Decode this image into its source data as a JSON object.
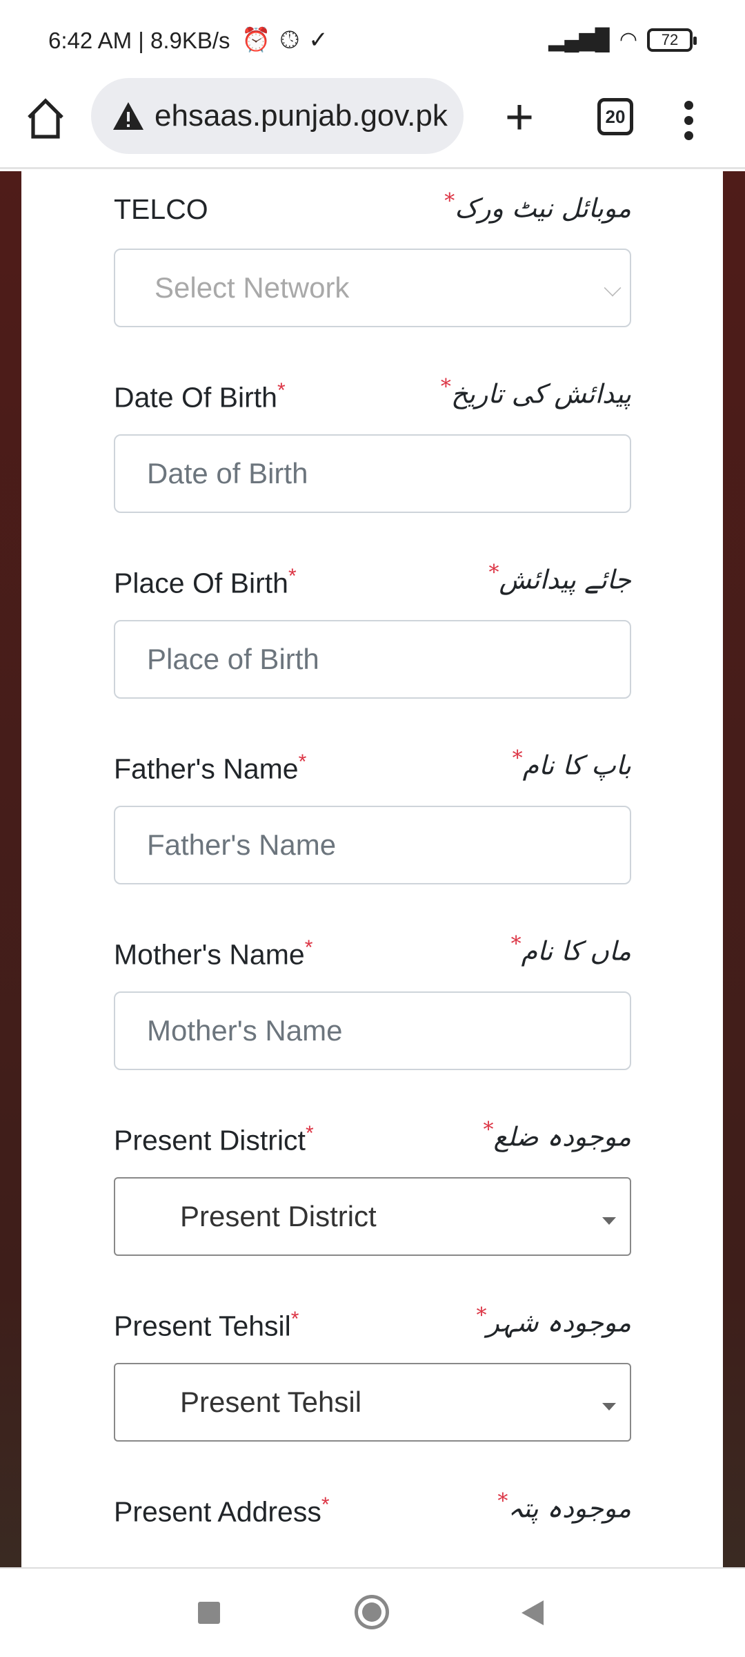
{
  "status_bar": {
    "time": "6:42 AM | 8.9KB/s",
    "battery": "72",
    "icons": [
      "alarm-icon",
      "clock-icon",
      "download-done-icon",
      "signal-icon",
      "wifi-icon",
      "battery-icon"
    ]
  },
  "browser": {
    "url": "ehsaas.punjab.gov.pk",
    "tab_count": "20",
    "icons": [
      "home-icon",
      "warning-icon",
      "plus-icon",
      "tabs-icon",
      "menu-icon"
    ]
  },
  "form": {
    "required_mark": "*",
    "fields": [
      {
        "label": "TELCO",
        "urdu": "موبائل نیٹ ورک",
        "placeholder": "Select Network",
        "type": "select-light"
      },
      {
        "label": "Date Of Birth",
        "urdu": "پیدائش کی تاریخ",
        "placeholder": "Date of Birth",
        "type": "input"
      },
      {
        "label": "Place Of Birth",
        "urdu": "جائے پیدائش",
        "placeholder": "Place of Birth",
        "type": "input"
      },
      {
        "label": "Father's Name",
        "urdu": "باپ کا نام",
        "placeholder": "Father's Name",
        "type": "input"
      },
      {
        "label": "Mother's Name",
        "urdu": "ماں کا نام",
        "placeholder": "Mother's Name",
        "type": "input"
      },
      {
        "label": "Present District",
        "urdu": "موجودہ ضلع",
        "placeholder": "Present District",
        "type": "select"
      },
      {
        "label": "Present Tehsil",
        "urdu": "موجودہ شہر",
        "placeholder": "Present Tehsil",
        "type": "select"
      },
      {
        "label": "Present Address",
        "urdu": "موجودہ پتہ",
        "type": "none"
      }
    ]
  },
  "colors": {
    "required": "#dc3545",
    "background": "#4f1c19"
  }
}
